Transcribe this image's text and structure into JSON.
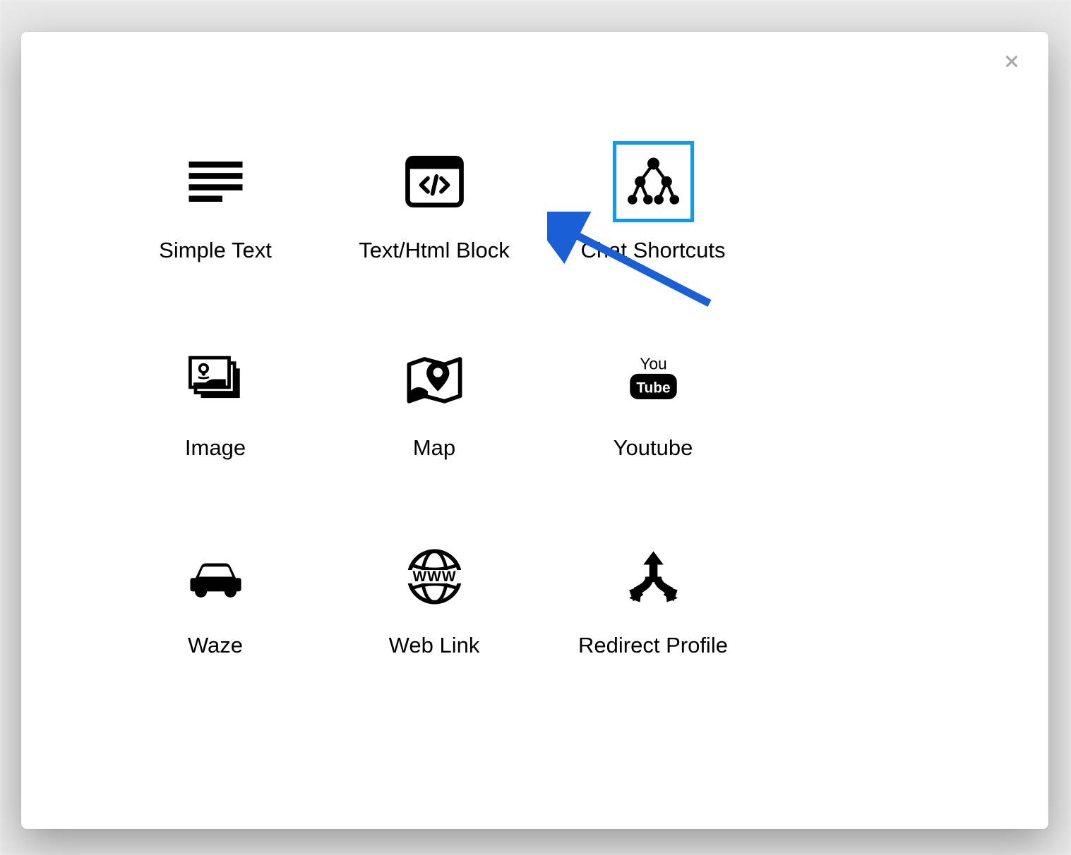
{
  "modal": {
    "close_label": "Close",
    "items": [
      {
        "label": "Simple Text",
        "icon": "text-lines-icon",
        "highlighted": false
      },
      {
        "label": "Text/Html Block",
        "icon": "code-block-icon",
        "highlighted": false
      },
      {
        "label": "Chat Shortcuts",
        "icon": "tree-graph-icon",
        "highlighted": true
      },
      {
        "label": "Image",
        "icon": "image-stack-icon",
        "highlighted": false
      },
      {
        "label": "Map",
        "icon": "map-pin-icon",
        "highlighted": false
      },
      {
        "label": "Youtube",
        "icon": "youtube-icon",
        "highlighted": false
      },
      {
        "label": "Waze",
        "icon": "car-icon",
        "highlighted": false
      },
      {
        "label": "Web Link",
        "icon": "www-globe-icon",
        "highlighted": false
      },
      {
        "label": "Redirect Profile",
        "icon": "split-arrows-icon",
        "highlighted": false
      }
    ],
    "annotation": {
      "icon": "arrow-pointer-icon",
      "color": "#1a5fd6"
    },
    "highlight_color": "#2196d6"
  }
}
